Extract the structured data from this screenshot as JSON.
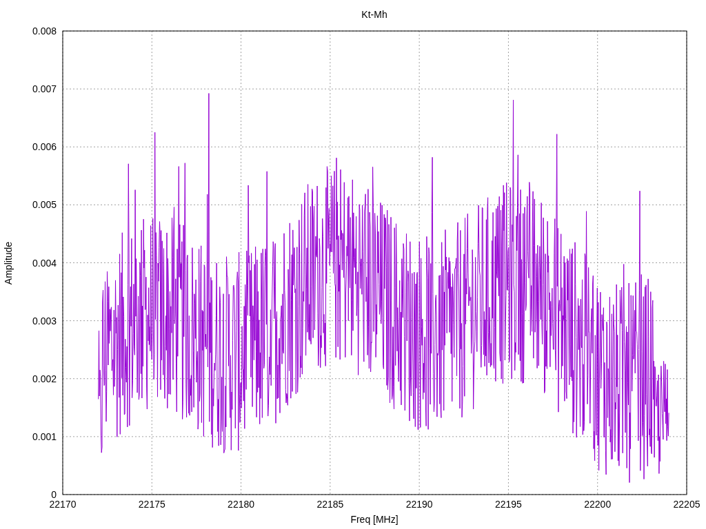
{
  "title": "Kt-Mh",
  "x_axis": {
    "label": "Freq [MHz]",
    "ticks": [
      "22170",
      "22175",
      "22180",
      "22185",
      "22190",
      "22195",
      "22200",
      "22205"
    ]
  },
  "y_axis": {
    "label": "Amplitude",
    "ticks": [
      "0.008",
      "0.007",
      "0.006",
      "0.005",
      "0.004",
      "0.003",
      "0.002",
      "0.001",
      "0"
    ]
  }
}
